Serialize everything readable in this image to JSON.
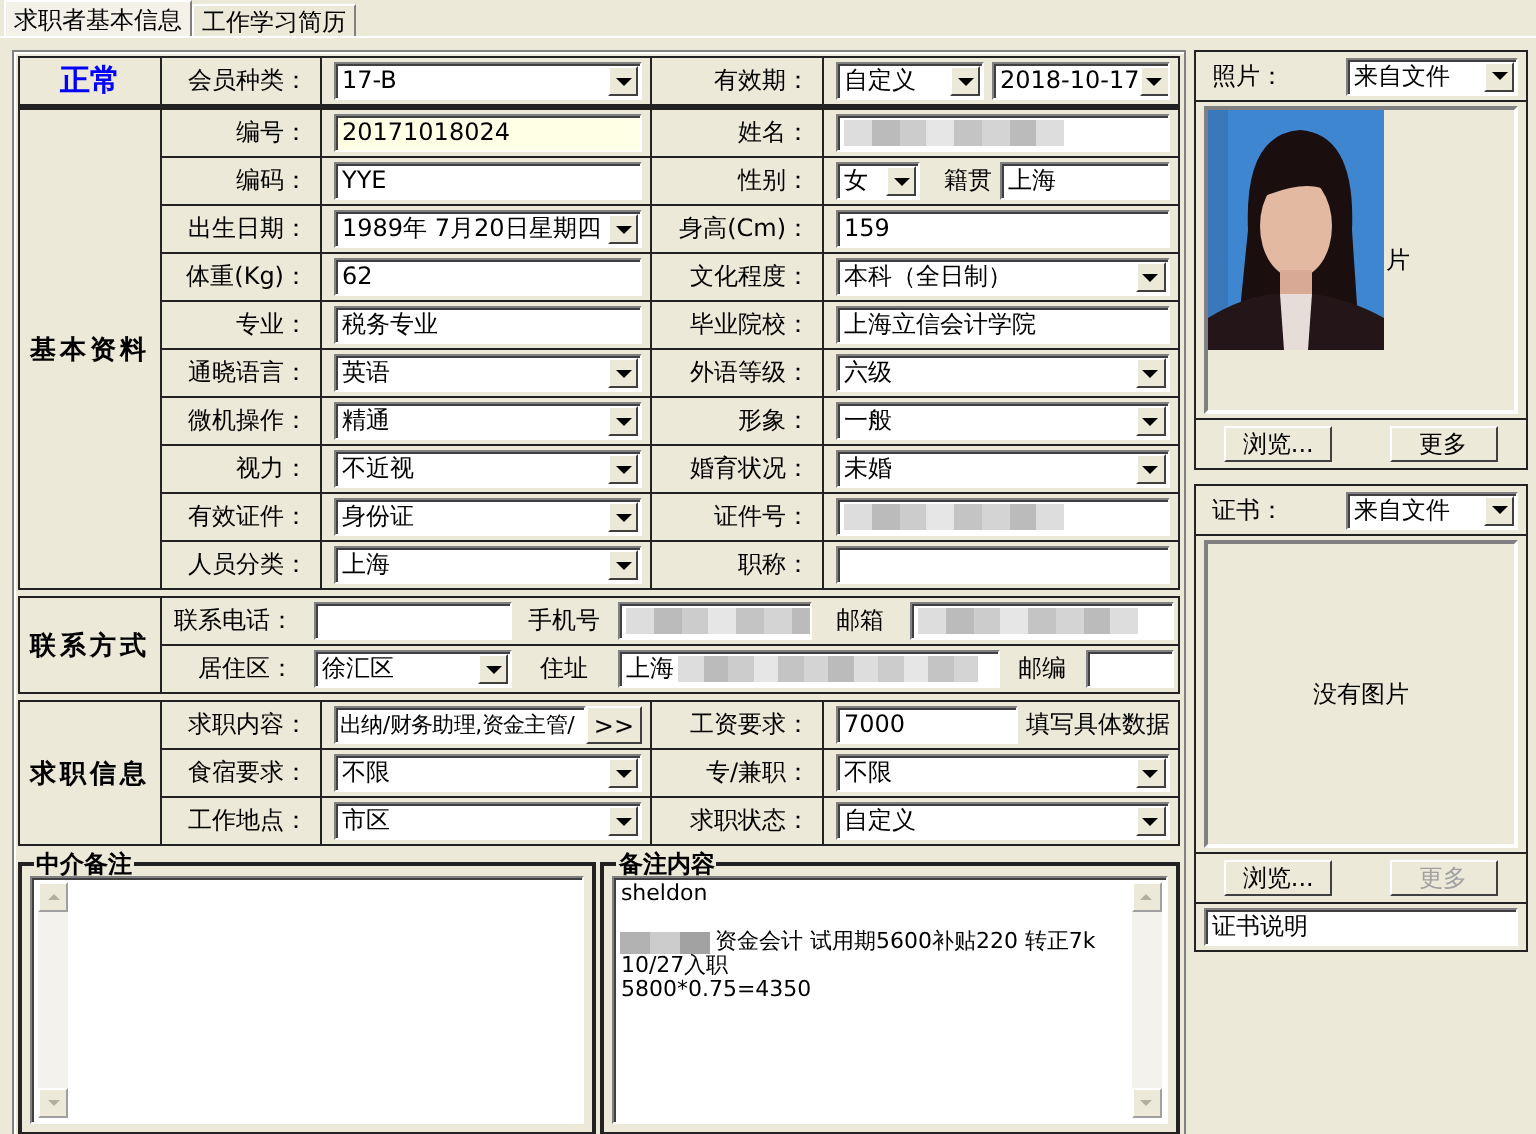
{
  "tabs": [
    {
      "label": "求职者基本信息",
      "selected": true
    },
    {
      "label": "工作学习简历",
      "selected": false
    }
  ],
  "status": "正常",
  "header": [
    {
      "label": "会员种类：",
      "kind": "combo",
      "value": "17-B"
    },
    {
      "label": "有效期：",
      "kind": "combo-pair",
      "value": "自定义",
      "value_2": "2018-10-17"
    }
  ],
  "basic": {
    "title": "基本资料",
    "rows": [
      [
        {
          "label": "编号：",
          "kind": "text",
          "value": "20171018024",
          "highlighted": true
        },
        {
          "label": "姓名：",
          "kind": "redacted"
        }
      ],
      [
        {
          "label": "编码：",
          "kind": "text",
          "value": "YYE",
          "highlighted": false
        },
        {
          "label": "性别：",
          "kind": "combo-text",
          "value": "女",
          "label_2": "籍贯",
          "value_2": "上海"
        }
      ],
      [
        {
          "label": "出生日期：",
          "kind": "combo",
          "value": "1989年 7月20日星期四"
        },
        {
          "label": "身高(Cm)：",
          "kind": "text",
          "value": "159",
          "highlighted": false
        }
      ],
      [
        {
          "label": "体重(Kg)：",
          "kind": "text",
          "value": "62",
          "highlighted": false
        },
        {
          "label": "文化程度：",
          "kind": "combo",
          "value": "本科（全日制）"
        }
      ],
      [
        {
          "label": "专业：",
          "kind": "text",
          "value": "税务专业",
          "highlighted": false
        },
        {
          "label": "毕业院校：",
          "kind": "text",
          "value": "上海立信会计学院",
          "highlighted": false
        }
      ],
      [
        {
          "label": "通晓语言：",
          "kind": "combo",
          "value": "英语"
        },
        {
          "label": "外语等级：",
          "kind": "combo",
          "value": "六级"
        }
      ],
      [
        {
          "label": "微机操作：",
          "kind": "combo",
          "value": "精通"
        },
        {
          "label": "形象：",
          "kind": "combo",
          "value": "一般"
        }
      ],
      [
        {
          "label": "视力：",
          "kind": "combo",
          "value": "不近视"
        },
        {
          "label": "婚育状况：",
          "kind": "combo",
          "value": "未婚"
        }
      ],
      [
        {
          "label": "有效证件：",
          "kind": "combo",
          "value": "身份证"
        },
        {
          "label": "证件号：",
          "kind": "redacted"
        }
      ],
      [
        {
          "label": "人员分类：",
          "kind": "combo",
          "value": "上海"
        },
        {
          "label": "职称：",
          "kind": "text",
          "highlighted": false
        }
      ]
    ]
  },
  "contact": {
    "title": "联系方式",
    "rows": [
      [
        {
          "label": "联系电话：",
          "kind": "text",
          "highlighted": false
        },
        {
          "label": "手机号",
          "kind": "redacted"
        },
        {
          "label": "邮箱",
          "kind": "redacted"
        }
      ],
      [
        {
          "label": "居住区：",
          "kind": "combo",
          "value": "徐汇区"
        },
        {
          "label": "住址",
          "kind": "partly-redacted",
          "value": "上海"
        },
        {
          "label": "邮编",
          "kind": "text",
          "highlighted": false
        }
      ]
    ]
  },
  "job": {
    "title": "求职信息",
    "rows": [
      [
        {
          "label": "求职内容：",
          "kind": "picker",
          "value": "出纳/财务助理,资金主管/",
          "button": ">>"
        },
        {
          "label": "工资要求：",
          "kind": "text-hint",
          "value": "7000",
          "hint": "填写具体数据"
        }
      ],
      [
        {
          "label": "食宿要求：",
          "kind": "combo",
          "value": "不限"
        },
        {
          "label": "专/兼职：",
          "kind": "combo",
          "value": "不限"
        }
      ],
      [
        {
          "label": "工作地点：",
          "kind": "combo",
          "value": "市区"
        },
        {
          "label": "求职状态：",
          "kind": "combo",
          "value": "自定义"
        }
      ]
    ]
  },
  "agent_notes": {
    "title": "中介备注"
  },
  "remarks": {
    "title": "备注内容",
    "paragraphs": [
      [
        {
          "text": "sheldon",
          "redacted_prefix": false
        }
      ],
      [
        {
          "text": "资金会计 试用期5600补贴220 转正7k",
          "redacted_prefix": true
        },
        {
          "text": "10/27入职",
          "redacted_prefix": false
        },
        {
          "text": "5800*0.75=4350",
          "redacted_prefix": false
        }
      ]
    ]
  },
  "photo": {
    "label": "照片：",
    "source": "来自文件",
    "visible_placeholder": "片",
    "buttons": [
      {
        "label": "浏览...",
        "disabled": false
      },
      {
        "label": "更多",
        "disabled": false
      }
    ]
  },
  "certificate": {
    "label": "证书：",
    "source": "来自文件",
    "placeholder": "没有图片",
    "buttons": [
      {
        "label": "浏览...",
        "disabled": false
      },
      {
        "label": "更多",
        "disabled": true
      }
    ],
    "caption": "证书说明"
  }
}
